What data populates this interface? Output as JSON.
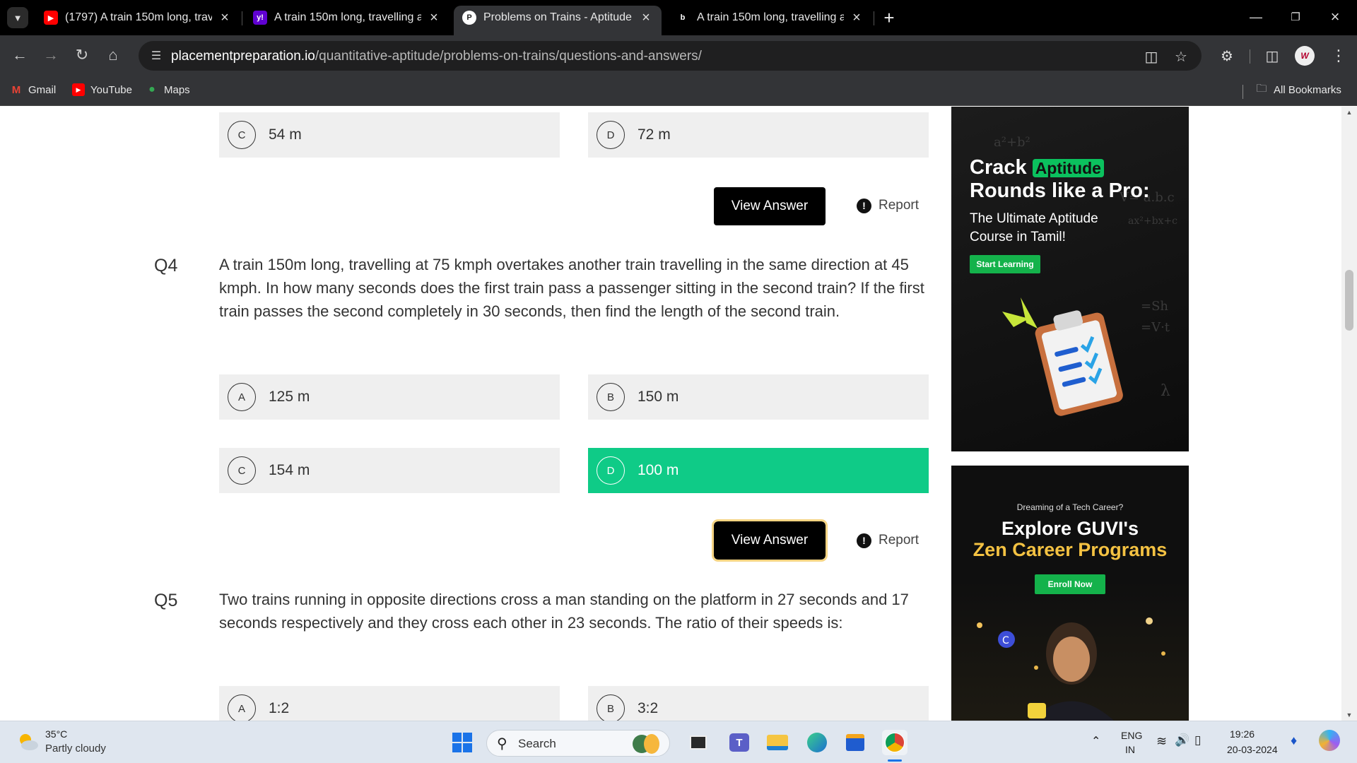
{
  "tabs": [
    {
      "title": "(1797) A train 150m long, travel",
      "favicon": "youtube-icon"
    },
    {
      "title": "A train 150m long, travelling at",
      "favicon": "yahoo-icon"
    },
    {
      "title": "Problems on Trains - Aptitude P",
      "favicon": "placementpreparation-icon"
    },
    {
      "title": "A train 150m long, travelling at",
      "favicon": "bing-icon"
    }
  ],
  "address": {
    "domain": "placementpreparation.io",
    "path": "/quantitative-aptitude/problems-on-trains/questions-and-answers/"
  },
  "bookmarks": [
    {
      "label": "Gmail",
      "icon": "gmail-icon"
    },
    {
      "label": "YouTube",
      "icon": "youtube-icon"
    },
    {
      "label": "Maps",
      "icon": "maps-icon"
    }
  ],
  "all_bookmarks_label": "All Bookmarks",
  "q3": {
    "options": [
      {
        "letter": "C",
        "value": "54 m"
      },
      {
        "letter": "D",
        "value": "72 m"
      }
    ],
    "view_answer": "View Answer",
    "report": "Report"
  },
  "q4": {
    "number": "Q4",
    "text": "A train 150m long, travelling at 75 kmph overtakes another train travelling in the same direction at 45 kmph. In how many seconds does the first train pass a passenger sitting in the second train? If the first train passes the second completely in 30 seconds, then find the length of the second train.",
    "options": [
      {
        "letter": "A",
        "value": "125 m"
      },
      {
        "letter": "B",
        "value": "150 m"
      },
      {
        "letter": "C",
        "value": "154 m"
      },
      {
        "letter": "D",
        "value": "100 m"
      }
    ],
    "correct": "D",
    "view_answer": "View Answer",
    "report": "Report"
  },
  "q5": {
    "number": "Q5",
    "text": "Two trains running in opposite directions cross a man standing on the platform in 27 seconds and 17 seconds respectively and they cross each other in 23 seconds. The ratio of their speeds is:",
    "options": [
      {
        "letter": "A",
        "value": "1:2"
      },
      {
        "letter": "B",
        "value": "3:2"
      }
    ]
  },
  "ads": {
    "ad1": {
      "title_a": "Crack",
      "title_highlight": "Aptitude",
      "title_b": "Rounds like a Pro:",
      "subtitle": "The Ultimate Aptitude Course in Tamil!",
      "cta": "Start Learning"
    },
    "ad2": {
      "kicker": "Dreaming of a Tech Career?",
      "title_a": "Explore GUVI's",
      "title_b": "Zen Career Programs",
      "cta": "Enroll Now"
    }
  },
  "taskbar": {
    "weather_temp": "35°C",
    "weather_desc": "Partly cloudy",
    "search_placeholder": "Search",
    "lang_1": "ENG",
    "lang_2": "IN",
    "time": "19:26",
    "date": "20-03-2024"
  },
  "colors": {
    "correct": "#0fcb87",
    "button": "#000000",
    "option_bg": "#efefef",
    "ad_cta": "#14b24b"
  }
}
